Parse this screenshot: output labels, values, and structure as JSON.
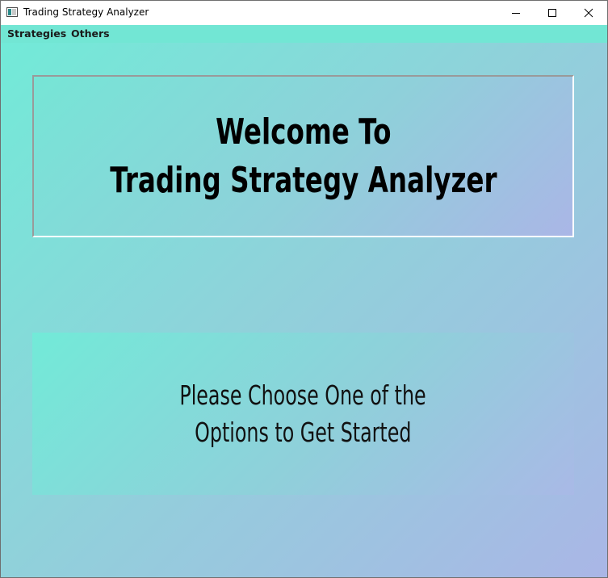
{
  "window": {
    "title": "Trading Strategy Analyzer"
  },
  "menu": {
    "items": [
      {
        "label": "Strategies"
      },
      {
        "label": "Others"
      }
    ]
  },
  "welcome": {
    "line1": "Welcome To",
    "line2": "Trading Strategy Analyzer"
  },
  "info": {
    "line1": "Please Choose One of the",
    "line2": "Options to Get Started"
  },
  "colors": {
    "menubar": "#72e6d4",
    "gradient_start": "#72ead8",
    "gradient_end": "#aab6e6"
  },
  "icons": {
    "app": "app-window-icon",
    "minimize": "minimize-icon",
    "maximize": "maximize-icon",
    "close": "close-icon"
  }
}
